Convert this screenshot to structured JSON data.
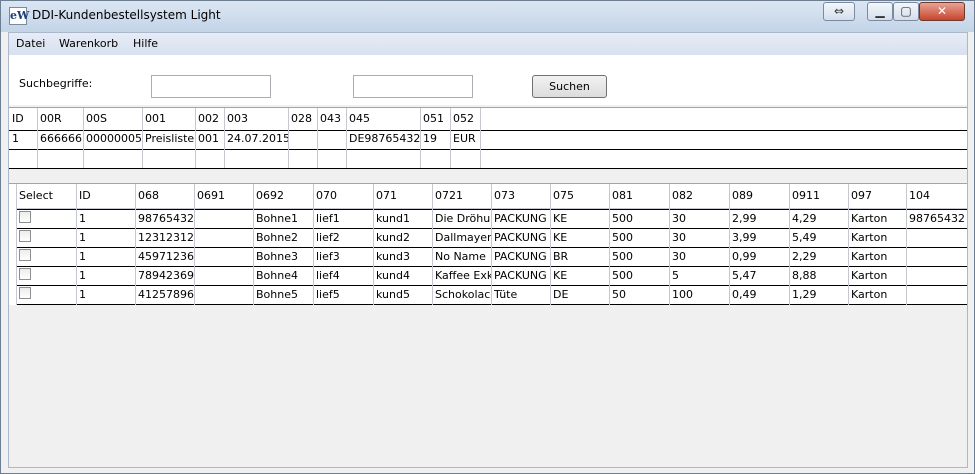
{
  "window": {
    "title": "DDI-Kundenbestellsystem Light",
    "min_label": "▁",
    "max_label": "▢",
    "close_label": "✕",
    "extra_label": "⇔"
  },
  "menu": {
    "items": [
      "Datei",
      "Warenkorb",
      "Hilfe"
    ]
  },
  "search": {
    "label": "Suchbegriffe:",
    "input1_value": "",
    "input2_value": "",
    "button_label": "Suchen"
  },
  "header_grid": {
    "columns": [
      "ID",
      "00R",
      "00S",
      "001",
      "002",
      "003",
      "028",
      "043",
      "045",
      "051",
      "052"
    ],
    "rows": [
      [
        "1",
        "666666",
        "00000005",
        "Preisliste",
        "001",
        "24.07.2015",
        "",
        "",
        "DE98765432",
        "19",
        "EUR"
      ]
    ]
  },
  "item_grid": {
    "columns": [
      "Select",
      "ID",
      "068",
      "0691",
      "0692",
      "070",
      "071",
      "0721",
      "073",
      "075",
      "081",
      "082",
      "089",
      "0911",
      "097",
      "104"
    ],
    "rows": [
      [
        "",
        "1",
        "98765432",
        "",
        "Bohne1",
        "lief1",
        "kund1",
        "Die Dröhu",
        "PACKUNG",
        "KE",
        "500",
        "30",
        "2,99",
        "4,29",
        "Karton",
        "98765432"
      ],
      [
        "",
        "1",
        "12312312",
        "",
        "Bohne2",
        "lief2",
        "kund2",
        "Dallmayer",
        "PACKUNG",
        "KE",
        "500",
        "30",
        "3,99",
        "5,49",
        "Karton",
        ""
      ],
      [
        "",
        "1",
        "45971236",
        "",
        "Bohne3",
        "lief3",
        "kund3",
        "No Name",
        "PACKUNG",
        "BR",
        "500",
        "30",
        "0,99",
        "2,29",
        "Karton",
        ""
      ],
      [
        "",
        "1",
        "78942369",
        "",
        "Bohne4",
        "lief4",
        "kund4",
        "Kaffee Exk",
        "PACKUNG",
        "KE",
        "500",
        "5",
        "5,47",
        "8,88",
        "Karton",
        ""
      ],
      [
        "",
        "1",
        "41257896",
        "",
        "Bohne5",
        "lief5",
        "kund5",
        "Schokolac",
        "Tüte",
        "DE",
        "50",
        "100",
        "0,49",
        "1,29",
        "Karton",
        ""
      ]
    ]
  }
}
